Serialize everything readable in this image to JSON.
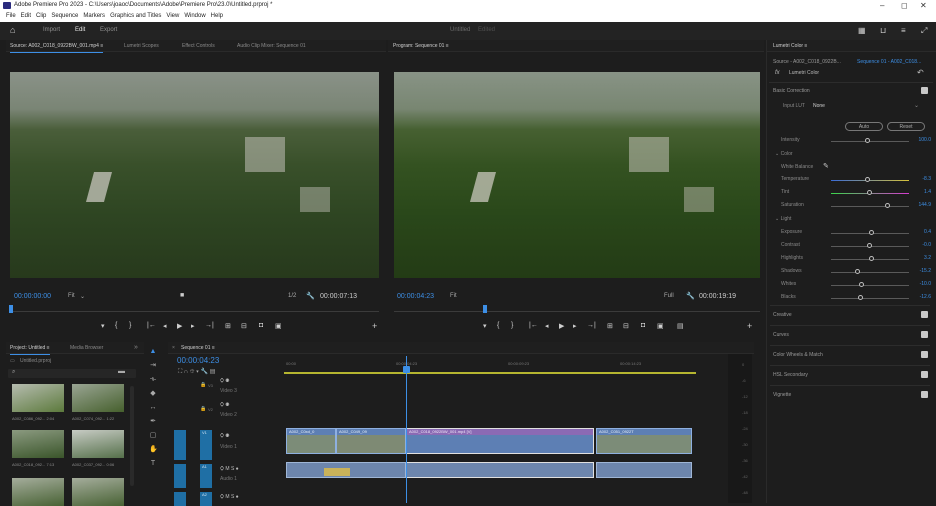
{
  "titlebar": {
    "title": "Adobe Premiere Pro 2023 - C:\\Users\\joaoc\\Documents\\Adobe\\Premiere Pro\\23.0\\Untitled.prproj *",
    "min": "–",
    "max": "◻",
    "close": "✕"
  },
  "menu": [
    "File",
    "Edit",
    "Clip",
    "Sequence",
    "Markers",
    "Graphics and Titles",
    "View",
    "Window",
    "Help"
  ],
  "workspace": {
    "import": "Import",
    "edit": "Edit",
    "export": "Export",
    "doc_title": "Untitled",
    "doc_state": "Edited"
  },
  "source_panel": {
    "tabs": [
      "Source: A002_C018_0922BW_001.mp4 ≡",
      "Lumetri Scopes",
      "Effect Controls",
      "Audio Clip Mixer: Sequence 01"
    ],
    "timecode": "00:00:00:00",
    "fit": "Fit",
    "ratio": "1/2",
    "duration": "00:00:07:13"
  },
  "program_panel": {
    "tab": "Program: Sequence 01 ≡",
    "timecode": "00:00:04:23",
    "fit": "Fit",
    "quality": "Full",
    "duration": "00:00:19:19"
  },
  "project_panel": {
    "tab": "Project: Untitled ≡",
    "tab2": "Media Browser",
    "file": "Untitled.prproj",
    "thumbs": [
      "A002_C086_092... 2:04",
      "A002_C074_092... 1:22",
      "A002_C018_092... 7:13",
      "A002_C037_092... 0:06"
    ]
  },
  "timeline": {
    "tab": "Sequence 01 ≡",
    "timecode": "00:00:04:23",
    "ruler": [
      "00:00",
      "00:00:04:23",
      "00:00:09:23",
      "00:00:14:23"
    ],
    "tracks": [
      "Video 3",
      "Video 2",
      "Video 1",
      "Audio 1"
    ],
    "track_ids": [
      "V3",
      "V2",
      "V1",
      "A1",
      "A2"
    ],
    "clips": [
      "A002_C0xd_0",
      "A002_C049_09",
      "A002_C018_0922BW_001.mp4 [V]",
      "A002_C051_0922T"
    ],
    "meter_labels": [
      "0",
      "-6",
      "-12",
      "-18",
      "-24",
      "-30",
      "-36",
      "-42",
      "-48"
    ]
  },
  "lumetri": {
    "tab": "Lumetri Color ≡",
    "source": "Source - A002_C018_0922B...",
    "seq": "Sequence 01 - A002_C018...",
    "fx": "fx",
    "effect": "Lumetri Color",
    "basic": "Basic Correction",
    "input_lut": "Input LUT",
    "lut_val": "None",
    "auto": "Auto",
    "reset": "Reset",
    "intensity": "Intensity",
    "intensity_val": "100.0",
    "color": "Color",
    "white_balance": "White Balance",
    "temp": "Temperature",
    "temp_val": "-8.3",
    "tint": "Tint",
    "tint_val": "1.4",
    "sat": "Saturation",
    "sat_val": "144.9",
    "light": "Light",
    "exposure": "Exposure",
    "exposure_val": "0.4",
    "contrast": "Contrast",
    "contrast_val": "-0.0",
    "highlights": "Highlights",
    "highlights_val": "3.2",
    "shadows": "Shadows",
    "shadows_val": "-15.2",
    "whites": "Whites",
    "whites_val": "-10.0",
    "blacks": "Blacks",
    "blacks_val": "-12.6",
    "sections": [
      "Creative",
      "Curves",
      "Color Wheels & Match",
      "HSL Secondary",
      "Vignette"
    ]
  },
  "colors": {
    "accent": "#3d8fe6",
    "panel": "#1d1d1d",
    "clip_video": "#5d7fb4",
    "clip_audio": "#6d86ad",
    "playhead": "#3d8fe6",
    "track_blue": "#1f6fa5"
  }
}
